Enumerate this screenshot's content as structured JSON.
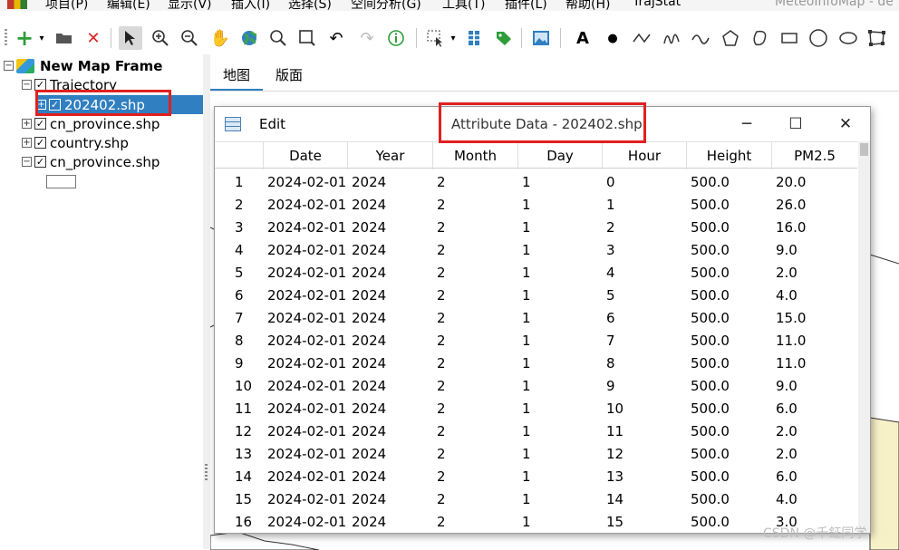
{
  "app": {
    "title": "MeteoInfoMap - de",
    "menu": [
      "项目(P)",
      "编辑(E)",
      "显示(V)",
      "插入(I)",
      "选择(S)",
      "空间分析(G)",
      "工具(T)",
      "插件(L)",
      "帮助(H)",
      "TrajStat"
    ]
  },
  "toolbar": {
    "tools": [
      "add-layer",
      "open-folder",
      "remove-layer",
      "select",
      "zoom-in",
      "zoom-out",
      "pan",
      "full-extent",
      "search",
      "zoom-box",
      "undo",
      "redo",
      "identify",
      "select-features",
      "attribute-table",
      "label",
      "add-picture",
      "text",
      "point",
      "polyline",
      "freehand",
      "curve",
      "polygon",
      "curve-polygon",
      "rectangle",
      "circle",
      "ellipse",
      "edit-vertices"
    ]
  },
  "layers": {
    "frame": "New Map Frame",
    "items": [
      {
        "name": "Trajectory",
        "expander": "⊟",
        "checked": "☑"
      },
      {
        "name": "202402.shp",
        "expander": "⊞",
        "checked": "☑"
      },
      {
        "name": "cn_province.shp",
        "expander": "⊞",
        "checked": "☑"
      },
      {
        "name": "country.shp",
        "expander": "⊞",
        "checked": "☑"
      },
      {
        "name": "cn_province.shp",
        "expander": "⊟",
        "checked": "☑"
      }
    ]
  },
  "map_tabs": [
    "地图",
    "版面"
  ],
  "attr_window": {
    "menu_edit": "Edit",
    "title": "Attribute Data - 202402.shp",
    "minimize": "─",
    "maximize": "☐",
    "close": "✕",
    "columns": [
      "",
      "Date",
      "Year",
      "Month",
      "Day",
      "Hour",
      "Height",
      "PM2.5"
    ],
    "rows": [
      [
        "1",
        "2024-02-01",
        "2024",
        "2",
        "1",
        "0",
        "500.0",
        "20.0"
      ],
      [
        "2",
        "2024-02-01",
        "2024",
        "2",
        "1",
        "1",
        "500.0",
        "26.0"
      ],
      [
        "3",
        "2024-02-01",
        "2024",
        "2",
        "1",
        "2",
        "500.0",
        "16.0"
      ],
      [
        "4",
        "2024-02-01",
        "2024",
        "2",
        "1",
        "3",
        "500.0",
        "9.0"
      ],
      [
        "5",
        "2024-02-01",
        "2024",
        "2",
        "1",
        "4",
        "500.0",
        "2.0"
      ],
      [
        "6",
        "2024-02-01",
        "2024",
        "2",
        "1",
        "5",
        "500.0",
        "4.0"
      ],
      [
        "7",
        "2024-02-01",
        "2024",
        "2",
        "1",
        "6",
        "500.0",
        "15.0"
      ],
      [
        "8",
        "2024-02-01",
        "2024",
        "2",
        "1",
        "7",
        "500.0",
        "11.0"
      ],
      [
        "9",
        "2024-02-01",
        "2024",
        "2",
        "1",
        "8",
        "500.0",
        "11.0"
      ],
      [
        "10",
        "2024-02-01",
        "2024",
        "2",
        "1",
        "9",
        "500.0",
        "9.0"
      ],
      [
        "11",
        "2024-02-01",
        "2024",
        "2",
        "1",
        "10",
        "500.0",
        "6.0"
      ],
      [
        "12",
        "2024-02-01",
        "2024",
        "2",
        "1",
        "11",
        "500.0",
        "2.0"
      ],
      [
        "13",
        "2024-02-01",
        "2024",
        "2",
        "1",
        "12",
        "500.0",
        "2.0"
      ],
      [
        "14",
        "2024-02-01",
        "2024",
        "2",
        "1",
        "13",
        "500.0",
        "6.0"
      ],
      [
        "15",
        "2024-02-01",
        "2024",
        "2",
        "1",
        "14",
        "500.0",
        "4.0"
      ],
      [
        "16",
        "2024-02-01",
        "2024",
        "2",
        "1",
        "15",
        "500.0",
        "3.0"
      ]
    ]
  },
  "watermark": "CSDN @千鉦同学",
  "colors": {
    "selection": "#2f7fc1",
    "highlight_box": "#e02020",
    "map_fill": "#f7f1c8"
  }
}
